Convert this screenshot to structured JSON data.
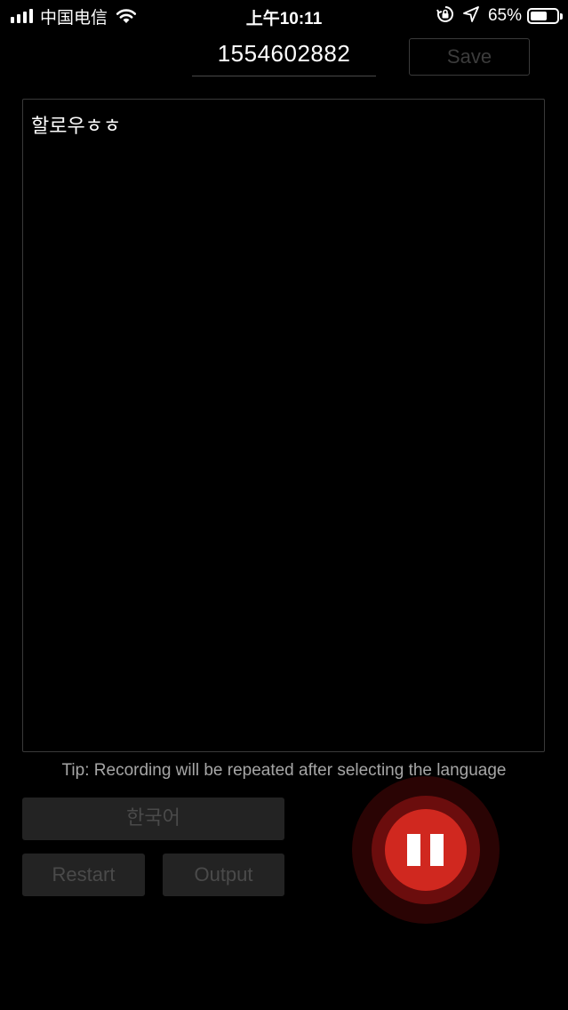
{
  "status_bar": {
    "carrier": "中国电信",
    "time": "上午10:11",
    "battery_percent": "65%",
    "battery_level": 0.65,
    "icons": [
      "signal-icon",
      "wifi-icon",
      "orientation-lock-icon",
      "location-icon",
      "battery-icon"
    ]
  },
  "header": {
    "id_value": "1554602882",
    "save_label": "Save"
  },
  "transcript": {
    "text": "할로우ㅎㅎ"
  },
  "tip": "Tip: Recording will be repeated after selecting the language",
  "controls": {
    "language_label": "한국어",
    "restart_label": "Restart",
    "output_label": "Output",
    "record_state": "pause-icon"
  },
  "colors": {
    "background": "#000000",
    "record_red": "#d0281f",
    "button_bg": "#232323",
    "disabled_text": "#4a4a4a"
  }
}
